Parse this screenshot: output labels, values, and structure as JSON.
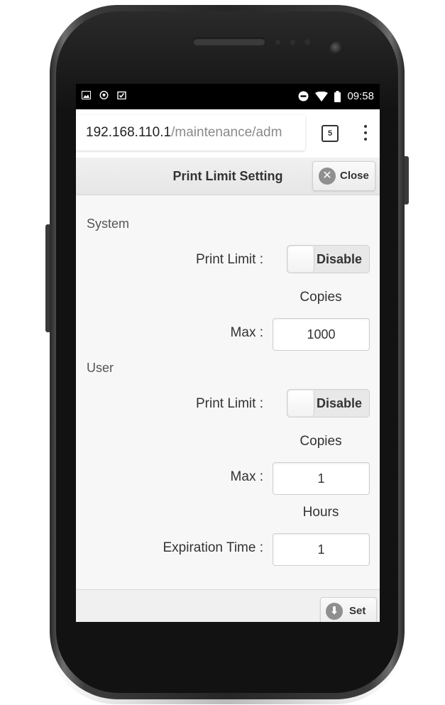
{
  "status_bar": {
    "time": "09:58",
    "left_icons": [
      "image-icon",
      "shield-icon",
      "clipboard-check-icon"
    ],
    "right_icons": [
      "do-not-disturb-icon",
      "wifi-icon",
      "battery-icon"
    ]
  },
  "browser": {
    "url_host": "192.168.110.1",
    "url_path": "/maintenance/adm",
    "tab_count": "5"
  },
  "header": {
    "title": "Print Limit Setting",
    "close_label": "Close"
  },
  "system": {
    "section_label": "System",
    "print_limit_label": "Print Limit :",
    "print_limit_state": "Disable",
    "copies_label": "Copies",
    "max_label": "Max :",
    "max_value": "1000"
  },
  "user": {
    "section_label": "User",
    "print_limit_label": "Print Limit :",
    "print_limit_state": "Disable",
    "copies_label": "Copies",
    "max_label": "Max :",
    "max_value": "1",
    "hours_label": "Hours",
    "expiration_label": "Expiration Time :",
    "expiration_value": "1"
  },
  "footer": {
    "set_label": "Set"
  }
}
